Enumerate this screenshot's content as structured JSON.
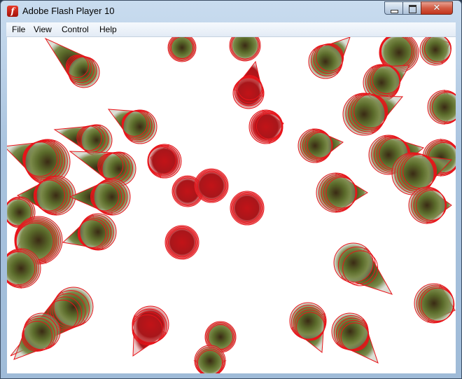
{
  "window": {
    "title": "Adobe Flash Player 10",
    "controls": {
      "minimize": "minimize",
      "maximize": "maximize",
      "close": "✕"
    }
  },
  "menu": [
    "File",
    "View",
    "Control",
    "Help"
  ],
  "stage": {
    "background": "#ffffff",
    "shape_stroke": "#e8141a"
  }
}
